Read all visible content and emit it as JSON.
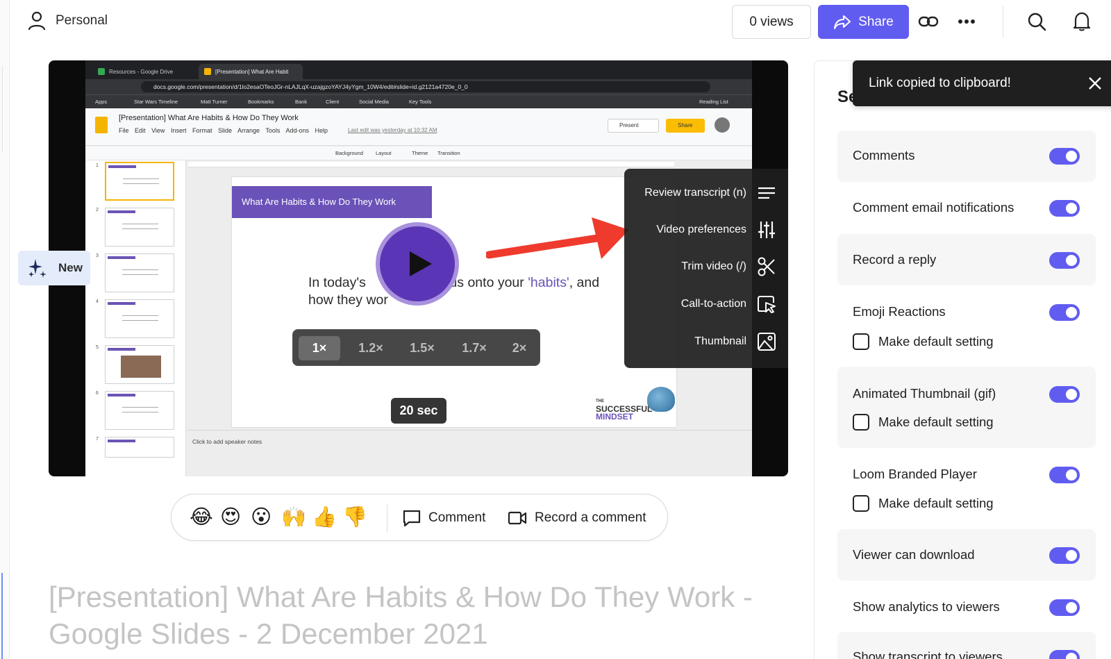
{
  "header": {
    "workspace_label": "Personal",
    "views_label": "0 views",
    "share_label": "Share"
  },
  "browser": {
    "tabs": [
      "Resources - Google Drive",
      "[Presentation] What Are Habit"
    ],
    "url": "docs.google.com/presentation/d/1lo2esaOTeoJGr-nLAJLqX-uzajgzoYAYJ4yYgm_10W4/edit#slide=id.g2121a4720e_0_0",
    "bookmarks": [
      "Apps",
      "Star Wars Timeline",
      "Matt Turner",
      "Bookmarks",
      "Bank",
      "Client",
      "Social Media",
      "Key Tools",
      "Reading List"
    ]
  },
  "slides_app": {
    "doc_title": "[Presentation] What Are Habits & How Do They Work",
    "menus": [
      "File",
      "Edit",
      "View",
      "Insert",
      "Format",
      "Slide",
      "Arrange",
      "Tools",
      "Add-ons",
      "Help"
    ],
    "last_edit": "Last edit was yesterday at 10:32 AM",
    "present_label": "Present",
    "share_label": "Share",
    "toolbar_items": [
      "Background",
      "Layout",
      "Theme",
      "Transition"
    ],
    "slide_numbers": [
      "1",
      "2",
      "3",
      "4",
      "5",
      "6",
      "7"
    ],
    "slide_title": "What Are Habits & How Do They Work",
    "slide_body_line1_a": "In today's",
    "slide_body_line1_b": "ocus onto your",
    "slide_body_highlight": "'habits'",
    "slide_body_line1_c": ", and",
    "slide_body_line2": "how they wor",
    "logo_small": "THE",
    "logo_line1": "SUCCESSFUL",
    "logo_line2": "MINDSET",
    "speaker_notes": "Click to add speaker notes"
  },
  "player": {
    "speeds": [
      "1×",
      "1.2×",
      "1.5×",
      "1.7×",
      "2×"
    ],
    "active_speed": "1×",
    "duration_badge": "20 sec",
    "menu": [
      {
        "label": "Review transcript (n)",
        "icon": "transcript-lines-icon"
      },
      {
        "label": "Video preferences",
        "icon": "sliders-icon"
      },
      {
        "label": "Trim video (/)",
        "icon": "scissors-icon"
      },
      {
        "label": "Call-to-action",
        "icon": "cursor-click-icon"
      },
      {
        "label": "Thumbnail",
        "icon": "image-icon"
      }
    ],
    "annotation_color": "#ee3b2e"
  },
  "new_badge": "New",
  "reactions": {
    "emojis": [
      "😂",
      "😍",
      "😮",
      "🙌",
      "👍",
      "👎"
    ],
    "comment_label": "Comment",
    "record_label": "Record a comment"
  },
  "page_title": "[Presentation] What Are Habits & How Do They Work - Google Slides - 2 December 2021",
  "settings_panel": {
    "title_visible": "Se",
    "toast": "Link copied to clipboard!",
    "items": [
      {
        "label": "Comments",
        "on": true
      },
      {
        "label": "Comment email notifications",
        "on": true
      },
      {
        "label": "Record a reply",
        "on": true
      },
      {
        "label": "Emoji Reactions",
        "on": true,
        "checkbox": "Make default setting"
      },
      {
        "label": "Animated Thumbnail (gif)",
        "on": true,
        "checkbox": "Make default setting"
      },
      {
        "label": "Loom Branded Player",
        "on": true,
        "checkbox": "Make default setting"
      },
      {
        "label": "Viewer can download",
        "on": true
      },
      {
        "label": "Show analytics to viewers",
        "on": true
      },
      {
        "label": "Show transcript to viewers",
        "on": true
      }
    ]
  },
  "colors": {
    "accent": "#615cf0",
    "play_button": "#5a35b5",
    "slide_purple": "#6a52b8"
  }
}
